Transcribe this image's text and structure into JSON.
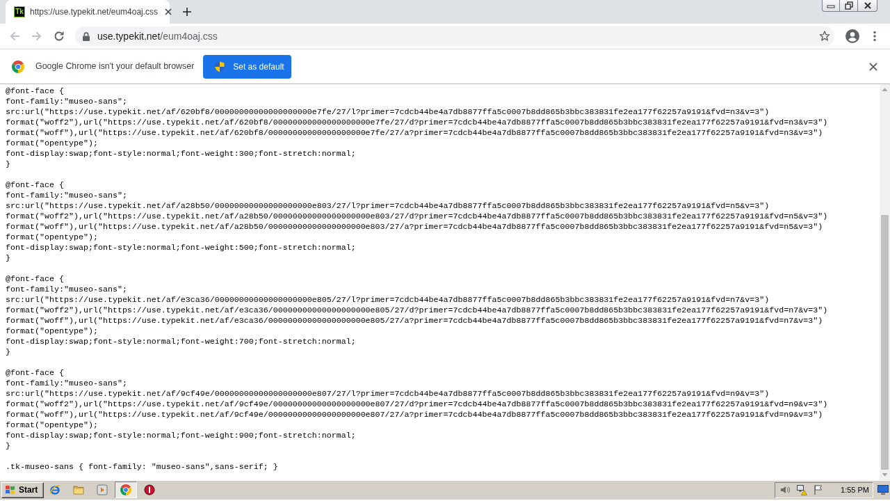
{
  "tabs": [
    {
      "favicon": "Tk",
      "title": "https://use.typekit.net/eum4oaj.css",
      "selected": true
    }
  ],
  "toolbar": {
    "back": {
      "disabled": true
    },
    "forward": {
      "disabled": true
    },
    "url": {
      "host": "use.typekit.net",
      "path": "/eum4oaj.css"
    }
  },
  "infobar": {
    "message": "Google Chrome isn't your default browser",
    "button": "Set as default"
  },
  "document": {
    "blocks": [
      {
        "lines": [
          "@font-face {",
          "font-family:\"museo-sans\";",
          "src:url(\"https://use.typekit.net/af/620bf8/00000000000000000000e7fe/27/l?primer=7cdcb44be4a7db8877ffa5c0007b8dd865b3bbc383831fe2ea177f62257a9191&fvd=n3&v=3\")",
          "format(\"woff2\"),url(\"https://use.typekit.net/af/620bf8/00000000000000000000e7fe/27/d?primer=7cdcb44be4a7db8877ffa5c0007b8dd865b3bbc383831fe2ea177f62257a9191&fvd=n3&v=3\")",
          "format(\"woff\"),url(\"https://use.typekit.net/af/620bf8/00000000000000000000e7fe/27/a?primer=7cdcb44be4a7db8877ffa5c0007b8dd865b3bbc383831fe2ea177f62257a9191&fvd=n3&v=3\")",
          "format(\"opentype\");",
          "font-display:swap;font-style:normal;font-weight:300;font-stretch:normal;",
          "}"
        ]
      },
      {
        "lines": [
          "@font-face {",
          "font-family:\"museo-sans\";",
          "src:url(\"https://use.typekit.net/af/a28b50/00000000000000000000e803/27/l?primer=7cdcb44be4a7db8877ffa5c0007b8dd865b3bbc383831fe2ea177f62257a9191&fvd=n5&v=3\")",
          "format(\"woff2\"),url(\"https://use.typekit.net/af/a28b50/00000000000000000000e803/27/d?primer=7cdcb44be4a7db8877ffa5c0007b8dd865b3bbc383831fe2ea177f62257a9191&fvd=n5&v=3\")",
          "format(\"woff\"),url(\"https://use.typekit.net/af/a28b50/00000000000000000000e803/27/a?primer=7cdcb44be4a7db8877ffa5c0007b8dd865b3bbc383831fe2ea177f62257a9191&fvd=n5&v=3\")",
          "format(\"opentype\");",
          "font-display:swap;font-style:normal;font-weight:500;font-stretch:normal;",
          "}"
        ]
      },
      {
        "lines": [
          "@font-face {",
          "font-family:\"museo-sans\";",
          "src:url(\"https://use.typekit.net/af/e3ca36/00000000000000000000e805/27/l?primer=7cdcb44be4a7db8877ffa5c0007b8dd865b3bbc383831fe2ea177f62257a9191&fvd=n7&v=3\")",
          "format(\"woff2\"),url(\"https://use.typekit.net/af/e3ca36/00000000000000000000e805/27/d?primer=7cdcb44be4a7db8877ffa5c0007b8dd865b3bbc383831fe2ea177f62257a9191&fvd=n7&v=3\")",
          "format(\"woff\"),url(\"https://use.typekit.net/af/e3ca36/00000000000000000000e805/27/a?primer=7cdcb44be4a7db8877ffa5c0007b8dd865b3bbc383831fe2ea177f62257a9191&fvd=n7&v=3\")",
          "format(\"opentype\");",
          "font-display:swap;font-style:normal;font-weight:700;font-stretch:normal;",
          "}"
        ]
      },
      {
        "lines": [
          "@font-face {",
          "font-family:\"museo-sans\";",
          "src:url(\"https://use.typekit.net/af/9cf49e/00000000000000000000e807/27/l?primer=7cdcb44be4a7db8877ffa5c0007b8dd865b3bbc383831fe2ea177f62257a9191&fvd=n9&v=3\")",
          "format(\"woff2\"),url(\"https://use.typekit.net/af/9cf49e/00000000000000000000e807/27/d?primer=7cdcb44be4a7db8877ffa5c0007b8dd865b3bbc383831fe2ea177f62257a9191&fvd=n9&v=3\")",
          "format(\"woff\"),url(\"https://use.typekit.net/af/9cf49e/00000000000000000000e807/27/a?primer=7cdcb44be4a7db8877ffa5c0007b8dd865b3bbc383831fe2ea177f62257a9191&fvd=n9&v=3\")",
          "format(\"opentype\");",
          "font-display:swap;font-style:normal;font-weight:900;font-stretch:normal;",
          "}"
        ]
      },
      {
        "lines": [
          ".tk-museo-sans { font-family: \"museo-sans\",sans-serif; }"
        ]
      }
    ]
  },
  "taskbar": {
    "start": "Start",
    "apps": [
      {
        "kind": "ie",
        "selected": false
      },
      {
        "kind": "folder",
        "selected": false
      },
      {
        "kind": "media",
        "selected": false
      },
      {
        "kind": "chrome",
        "selected": true
      },
      {
        "kind": "stop",
        "selected": false
      }
    ],
    "clock": "1:55 PM"
  }
}
